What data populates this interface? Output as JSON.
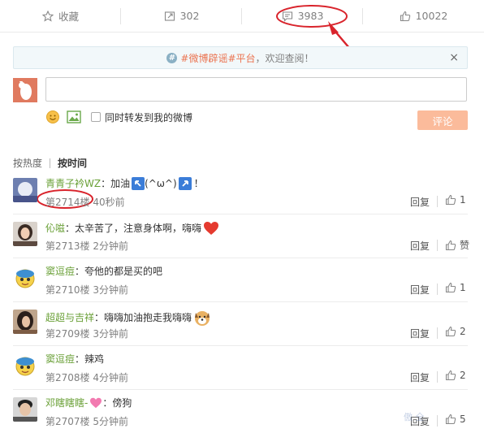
{
  "action_bar": {
    "favorite_label": "收藏",
    "repost_count": "302",
    "comment_count": "3983",
    "like_count": "10022"
  },
  "notice": {
    "hashtag": "#微博辟谣#平台",
    "rest": "，欢迎查阅！",
    "close": "×"
  },
  "composer": {
    "input_value": "",
    "repost_label": "同时转发到我的微博",
    "submit_label": "评论"
  },
  "sort_tabs": {
    "hot": "按热度",
    "time": "按时间"
  },
  "comments": [
    {
      "user": "青青子衿WZ",
      "colon": "：",
      "text": "加油",
      "text2": "(^ω^)",
      "tail": "！",
      "floor": "第2714楼",
      "time": "40秒前",
      "reply": "回复",
      "likes": "1"
    },
    {
      "user": "伈嗞",
      "colon": "：",
      "text": "太辛苦了，注意身体啊，嗨嗨",
      "floor": "第2713楼",
      "time": "2分钟前",
      "reply": "回复",
      "likes": "赞"
    },
    {
      "user": "窦逗痘",
      "colon": "：",
      "text": "夸他的都是买的吧",
      "floor": "第2710楼",
      "time": "3分钟前",
      "reply": "回复",
      "likes": "1"
    },
    {
      "user": "超超与吉祥",
      "colon": "：",
      "text": "嗨嗨加油抱走我嗨嗨",
      "floor": "第2709楼",
      "time": "3分钟前",
      "reply": "回复",
      "likes": "2"
    },
    {
      "user": "窦逗痘",
      "colon": "：",
      "text": "辣鸡",
      "floor": "第2708楼",
      "time": "4分钟前",
      "reply": "回复",
      "likes": "2"
    },
    {
      "user": "邓瞎瞎瞎-",
      "colon": "：",
      "text": "傍狗",
      "floor": "第2707楼",
      "time": "5分钟前",
      "reply": "回复",
      "likes": "5"
    }
  ],
  "watermark": "傲 全"
}
